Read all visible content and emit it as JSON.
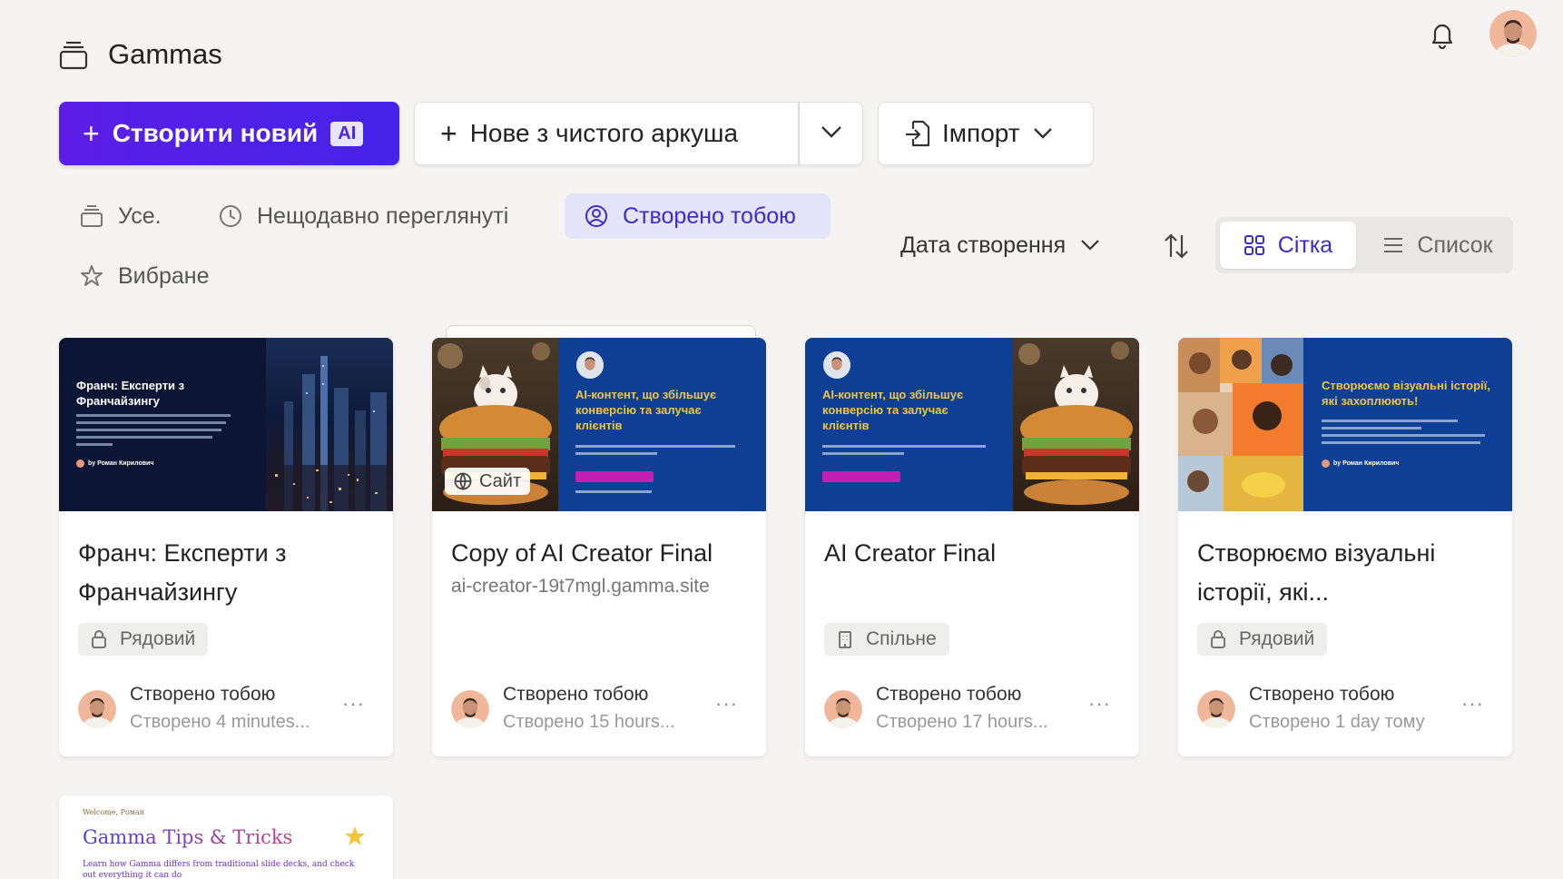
{
  "app": {
    "title": "Gammas"
  },
  "actions": {
    "create_new": "Створити новий",
    "ai_badge": "AI",
    "blank": "Нове з чистого аркуша",
    "import": "Імпорт"
  },
  "filters": {
    "all": "Усе.",
    "recent": "Нещодавно переглянуті",
    "mine": "Створено тобою",
    "favorites": "Вибране"
  },
  "sort": {
    "label": "Дата створення"
  },
  "view": {
    "grid": "Сітка",
    "list": "Список",
    "active": "grid"
  },
  "cards": [
    {
      "title": "Франч: Експерти з Франчайзингу",
      "subtitle": "",
      "badge": "Рядовий",
      "badge_icon": "lock-icon",
      "owner": "Створено тобою",
      "time": "Створено 4 minutes...",
      "thumb_title": "Франч: Експерти з Франчайзингу",
      "thumb_author": "by Роман Кирилович"
    },
    {
      "title": "Copy of AI Creator Final",
      "subtitle": "ai-creator-19t7mgl.gamma.site",
      "badge": "",
      "owner": "Створено тобою",
      "time": "Створено 15 hours...",
      "site_label": "Сайт",
      "thumb_title": "AI-контент, що збільшує конверсію та залучає клієнтів"
    },
    {
      "title": "AI Creator Final",
      "subtitle": "",
      "badge": "Спільне",
      "badge_icon": "building-icon",
      "owner": "Створено тобою",
      "time": "Створено 17 hours...",
      "thumb_title": "AI-контент, що збільшує конверсію та залучає клієнтів"
    },
    {
      "title": "Створюємо візуальні історії, які...",
      "subtitle": "",
      "badge": "Рядовий",
      "badge_icon": "lock-icon",
      "owner": "Створено тобою",
      "time": "Створено 1 day тому",
      "thumb_title": "Створюємо візуальні історії, які захоплюють!",
      "thumb_author": "by Роман Кирилович"
    }
  ],
  "card5": {
    "welcome": "Welcome, Роман",
    "title": "Gamma Tips & Tricks",
    "desc": "Learn how Gamma differs from traditional slide decks, and check out everything it can do"
  },
  "colors": {
    "primary": "#5c1ee6",
    "accent_text": "#3a2cd1",
    "active_filter_bg": "#e6e4fb",
    "slide_blue": "#0d3f95",
    "slide_dark": "#0c1533",
    "slide_yellow": "#f2c53d"
  }
}
